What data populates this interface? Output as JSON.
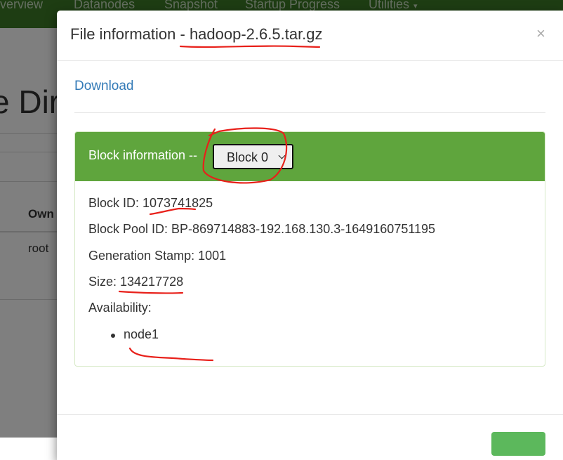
{
  "nav": {
    "items": [
      "Overview",
      "Datanodes",
      "Snapshot",
      "Startup Progress",
      "Utilities"
    ]
  },
  "background": {
    "title_fragment": "e Dir",
    "table_header": "Own",
    "table_cell": "root"
  },
  "modal": {
    "title": "File information - hadoop-2.6.5.tar.gz",
    "close_symbol": "×",
    "download_label": "Download",
    "block_panel": {
      "title": "Block information --",
      "selected_block": "Block 0",
      "block_id": "Block ID: 1073741825",
      "block_pool_id": "Block Pool ID: BP-869714883-192.168.130.3-1649160751195",
      "generation_stamp": "Generation Stamp: 1001",
      "size": "Size: 134217728",
      "availability_label": "Availability:",
      "nodes": [
        "node1"
      ]
    }
  },
  "colors": {
    "navbar": "#3d7a26",
    "panel_heading": "#5fa53d",
    "link": "#337ab7",
    "annotation": "#e8201a"
  },
  "icons": {
    "close": "close-icon",
    "select_chevron": "chevron-down-icon"
  }
}
